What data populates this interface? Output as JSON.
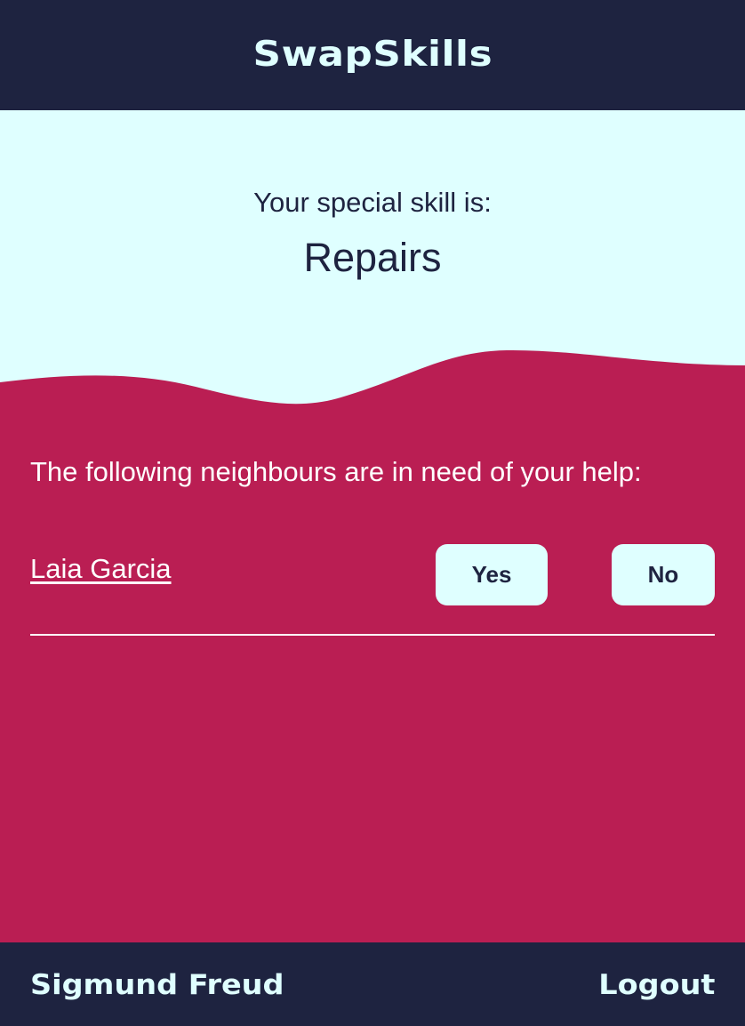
{
  "app": {
    "title": "SwapSkills"
  },
  "skill": {
    "intro": "Your special skill is:",
    "name": "Repairs"
  },
  "requests": {
    "intro": "The following neighbours are in need of your help:",
    "items": [
      {
        "name": "Laia Garcia",
        "yes_label": "Yes",
        "no_label": "No"
      }
    ]
  },
  "footer": {
    "user_name": "Sigmund Freud",
    "logout_label": "Logout"
  },
  "colors": {
    "navy": "#1E2340",
    "light_cyan": "#DFFFFF",
    "crimson": "#BA1E53",
    "white": "#FFFFFF"
  }
}
